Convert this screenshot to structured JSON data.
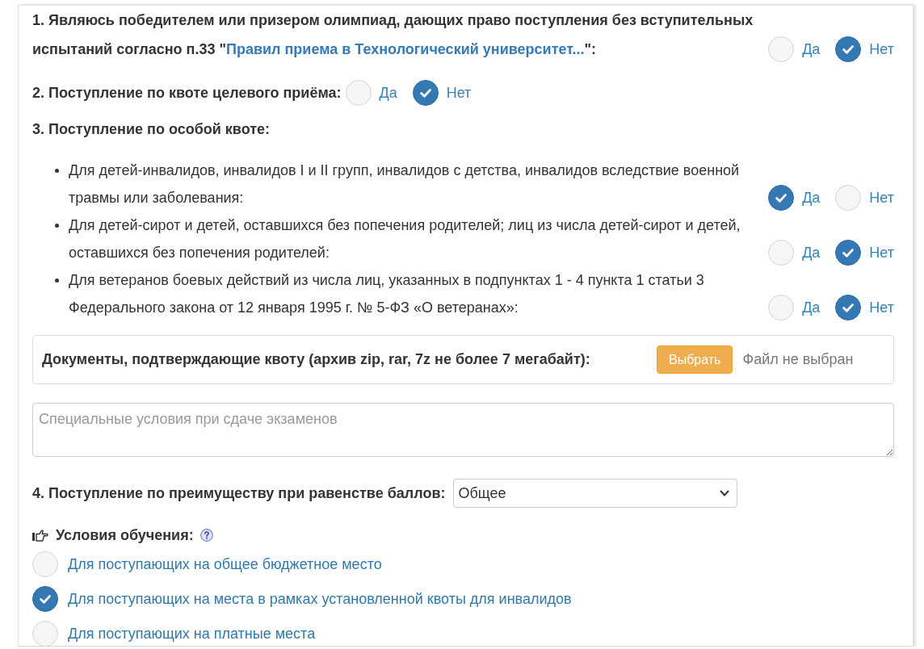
{
  "questions": [
    {
      "kind": "yesno",
      "label": "1. Являюсь победителем или призером олимпиад, дающих право поступления без вступительных испытаний согласно п.33 \"",
      "link": "Правил приема в Технологический университет...",
      "label_end": "\":",
      "options": [
        {
          "label": "Да",
          "selected": false
        },
        {
          "label": "Нет",
          "selected": true
        }
      ]
    },
    {
      "kind": "yesno",
      "label": "2. Поступление по квоте целевого приёма:",
      "options": [
        {
          "label": "Да",
          "selected": false
        },
        {
          "label": "Нет",
          "selected": true
        }
      ]
    },
    {
      "kind": "quota",
      "label": "3. Поступление по особой квоте:",
      "items": [
        {
          "label": "Для детей-инвалидов, инвалидов I и II групп, инвалидов с детства, инвалидов вследствие военной травмы или заболевания:",
          "options": [
            {
              "label": "Да",
              "selected": true
            },
            {
              "label": "Нет",
              "selected": false
            }
          ]
        },
        {
          "label": "Для детей-сирот и детей, оставшихся без попечения родителей; лиц из числа детей-сирот и детей, оставшихся без попечения родителей:",
          "options": [
            {
              "label": "Да",
              "selected": false
            },
            {
              "label": "Нет",
              "selected": true
            }
          ]
        },
        {
          "label": "Для ветеранов боевых действий из числа лиц, указанных в подпунктах 1 - 4 пункта 1 статьи 3 Федерального закона от 12 января 1995 г. № 5-ФЗ «О ветеранах»:",
          "options": [
            {
              "label": "Да",
              "selected": false
            },
            {
              "label": "Нет",
              "selected": true
            }
          ]
        }
      ],
      "documents": {
        "label": "Документы, подтверждающие квоту (архив zip, rar, 7z не более 7 мегабайт):",
        "button": "Выбрать",
        "file_status": "Файл не выбран"
      },
      "special_conditions": {
        "placeholder": "Специальные условия при сдаче экзаменов"
      }
    },
    {
      "kind": "select",
      "label": "4. Поступление по преимуществу при равенстве баллов:",
      "value": "Общее"
    }
  ],
  "study_conditions": {
    "label": "Условия обучения:",
    "options": [
      {
        "label": "Для поступающих на общее бюджетное место",
        "selected": false
      },
      {
        "label": "Для поступающих на места в рамках установленной квоты для инвалидов",
        "selected": true
      },
      {
        "label": "Для поступающих на платные места",
        "selected": false
      }
    ]
  }
}
